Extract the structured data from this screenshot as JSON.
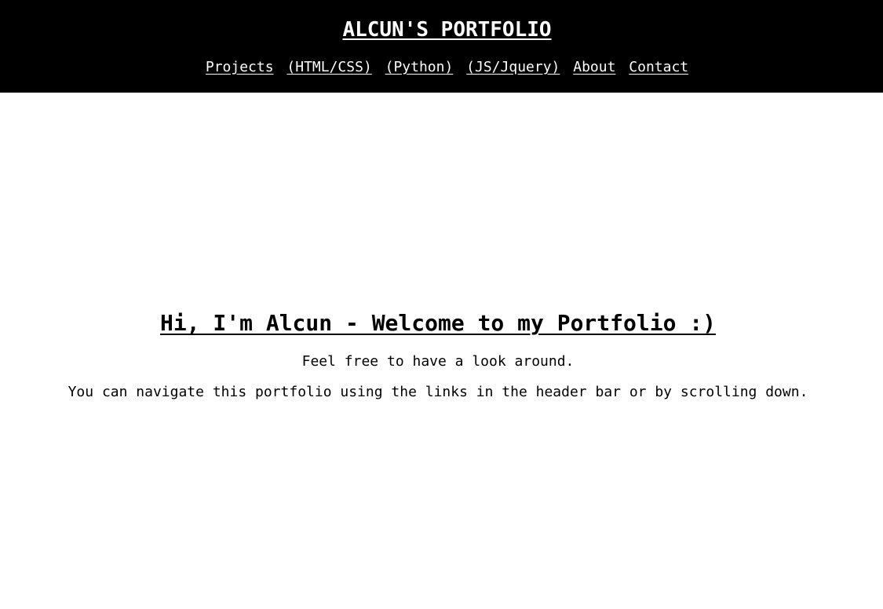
{
  "header": {
    "title": "ALCUN'S PORTFOLIO",
    "nav": [
      {
        "label": "Projects"
      },
      {
        "label": "(HTML/CSS)"
      },
      {
        "label": "(Python)"
      },
      {
        "label": "(JS/Jquery)"
      },
      {
        "label": "About"
      },
      {
        "label": "Contact"
      }
    ]
  },
  "main": {
    "heading": "Hi, I'm Alcun - Welcome to my Portfolio :)",
    "line1": "Feel free to have a look around.",
    "line2": "You can navigate this portfolio using the links in the header bar or by scrolling down."
  },
  "colors": {
    "header_bg": "#000000",
    "header_text": "#ffffff",
    "page_bg": "#ffffff",
    "body_text": "#000000"
  }
}
